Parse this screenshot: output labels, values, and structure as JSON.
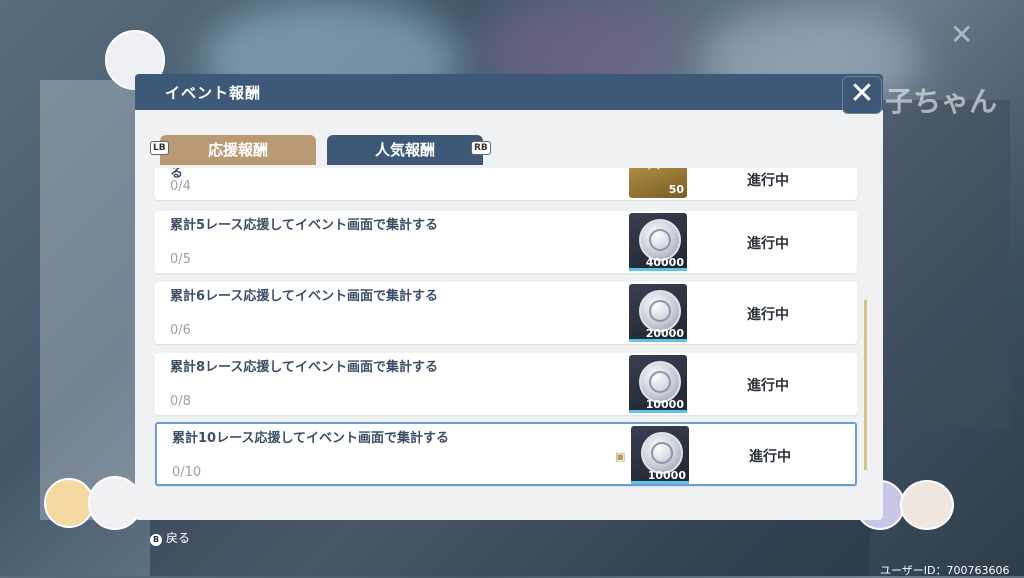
{
  "background": {
    "title_partial": "子ちゃん",
    "close_glyph": "✕"
  },
  "dialog": {
    "title": "イベント報酬",
    "close_glyph": "✕",
    "tabs": [
      {
        "label": "応援報酬",
        "key": "LB",
        "active": false
      },
      {
        "label": "人気報酬",
        "key": "RB",
        "active": true
      }
    ],
    "rows": [
      {
        "title": "る",
        "progress": "0/4",
        "item": "star-item",
        "count": "50",
        "status": "進行中"
      },
      {
        "title": "累計5レース応援してイベント画面で集計する",
        "progress": "0/5",
        "item": "coin-item",
        "count": "40000",
        "status": "進行中"
      },
      {
        "title": "累計6レース応援してイベント画面で集計する",
        "progress": "0/6",
        "item": "coin-item",
        "count": "20000",
        "status": "進行中"
      },
      {
        "title": "累計8レース応援してイベント画面で集計する",
        "progress": "0/8",
        "item": "coin-item",
        "count": "10000",
        "status": "進行中"
      },
      {
        "title": "累計10レース応援してイベント画面で集計する",
        "progress": "0/10",
        "item": "coin-item",
        "count": "10000",
        "status": "進行中"
      }
    ]
  },
  "footer": {
    "back_key": "B",
    "back_label": "戻る",
    "user_id": "ユーザーID：700763606"
  },
  "colors": {
    "header": "#3e5878",
    "tab_inactive": "#b89a74",
    "progress_bar": "#5fc3e4",
    "selected_border": "#6d9cd4"
  }
}
